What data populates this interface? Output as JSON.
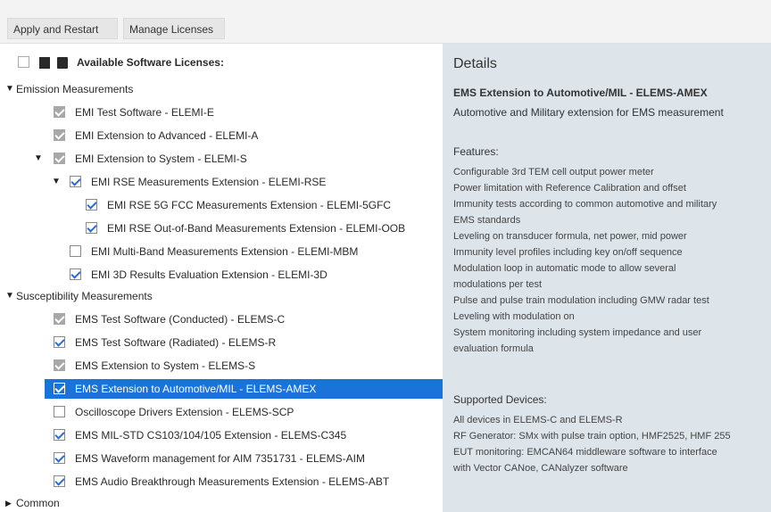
{
  "toolbar": {
    "apply_label": "Apply and Restart",
    "manage_label": "Manage Licenses"
  },
  "tree": {
    "header": "Available Software Licenses:",
    "groups": [
      {
        "label": "Emission Measurements"
      },
      {
        "label": "Susceptibility Measurements"
      },
      {
        "label": "Common"
      }
    ],
    "items": [
      {
        "label": "EMI Test Software  -  ELEMI-E",
        "state": "disabled"
      },
      {
        "label": "EMI Extension to Advanced  -  ELEMI-A",
        "state": "disabled"
      },
      {
        "label": "EMI Extension to System  -  ELEMI-S",
        "state": "disabled"
      },
      {
        "label": "EMI RSE Measurements Extension  -  ELEMI-RSE",
        "state": "checked"
      },
      {
        "label": "EMI RSE 5G FCC Measurements Extension  -  ELEMI-5GFC",
        "state": "checked"
      },
      {
        "label": "EMI RSE Out-of-Band Measurements Extension  -  ELEMI-OOB",
        "state": "checked"
      },
      {
        "label": "EMI Multi-Band Measurements Extension  -  ELEMI-MBM",
        "state": "unchecked"
      },
      {
        "label": "EMI 3D Results Evaluation Extension  -  ELEMI-3D",
        "state": "checked"
      },
      {
        "label": "EMS Test Software (Conducted)  -  ELEMS-C",
        "state": "disabled"
      },
      {
        "label": "EMS Test Software (Radiated)  -  ELEMS-R",
        "state": "checked"
      },
      {
        "label": "EMS Extension to System  -  ELEMS-S",
        "state": "disabled"
      },
      {
        "label": "EMS Extension to Automotive/MIL  -  ELEMS-AMEX",
        "state": "checked"
      },
      {
        "label": "Oscilloscope Drivers Extension  -  ELEMS-SCP",
        "state": "unchecked"
      },
      {
        "label": "EMS MIL-STD CS103/104/105 Extension  -  ELEMS-C345",
        "state": "checked"
      },
      {
        "label": "EMS Waveform management for AIM 7351731  -  ELEMS-AIM",
        "state": "checked"
      },
      {
        "label": "EMS Audio Breakthrough Measurements Extension  -  ELEMS-ABT",
        "state": "checked"
      }
    ]
  },
  "details": {
    "title": "Details",
    "product": "EMS Extension to Automotive/MIL  -  ELEMS-AMEX",
    "description": "Automotive and Military extension for EMS measurement",
    "features_heading": "Features:",
    "features": [
      "Configurable 3rd TEM cell output power meter",
      "Power limitation with Reference Calibration and offset",
      "Immunity tests according to common automotive and military",
      "EMS standards",
      "Leveling on transducer formula, net power, mid power",
      "Immunity level profiles including key on/off sequence",
      "Modulation loop in automatic mode to allow several",
      "modulations per test",
      "Pulse and pulse train modulation including GMW radar test",
      "Leveling with modulation on",
      "System monitoring including system impedance and user",
      "evaluation formula"
    ],
    "devices_heading": "Supported Devices:",
    "devices": [
      "All devices in ELEMS-C and ELEMS-R",
      "RF Generator: SMx with pulse train option, HMF2525, HMF 255",
      "EUT monitoring: EMCAN64 middleware software to interface",
      "with Vector CANoe, CANalyzer software"
    ]
  }
}
